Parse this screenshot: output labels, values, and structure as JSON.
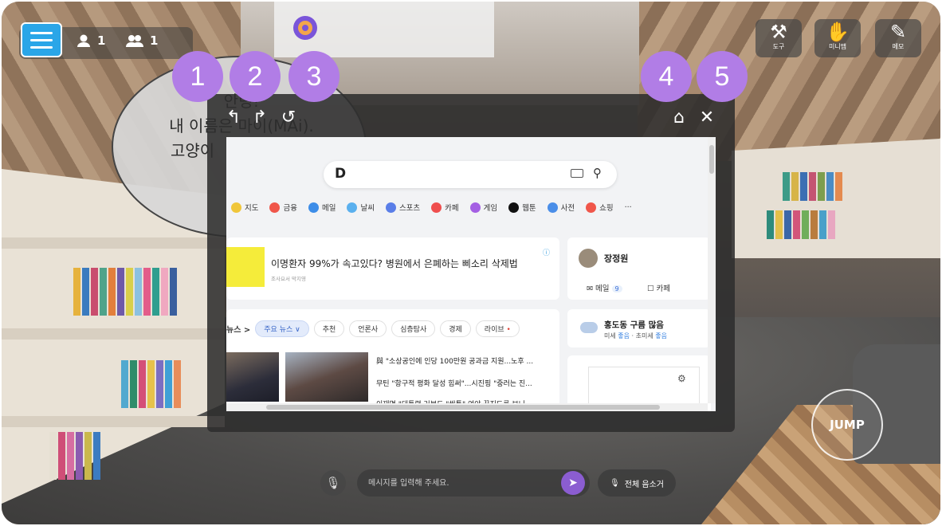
{
  "colors": {
    "accent": "#b17de6",
    "menu": "#2aa6e8",
    "send": "#8b5dd1"
  },
  "hud": {
    "menu_icon": "hamburger-icon",
    "participants_icon": "person-icon",
    "participants_count": "1",
    "group_icon": "group-icon",
    "group_count": "1"
  },
  "tools": [
    {
      "icon": "wrench-icon",
      "glyph": "⚒",
      "label": "도구"
    },
    {
      "icon": "minimap-icon",
      "glyph": "✋",
      "label": "미니맵"
    },
    {
      "icon": "memo-icon",
      "glyph": "✎",
      "label": "메모"
    }
  ],
  "badges": [
    "1",
    "2",
    "3",
    "4",
    "5"
  ],
  "speech": {
    "line1": "안녕!",
    "line2": "내 이름은 마이(MAi).",
    "line3": "고양이"
  },
  "browser": {
    "back_icon": "back-arrow-icon",
    "forward_icon": "forward-arrow-icon",
    "refresh_icon": "refresh-icon",
    "home_icon": "home-icon",
    "close_icon": "close-icon",
    "search_logo": "D",
    "categories": [
      "지도",
      "금융",
      "메일",
      "날씨",
      "스포츠",
      "카페",
      "게임",
      "웹툰",
      "사전",
      "쇼핑"
    ],
    "ad": {
      "title": "이명환자 99%가 속고있다? 병원에서 은폐하는 삐소리 삭제법",
      "sub": "조사요서 막지영"
    },
    "user": {
      "name": "장정원",
      "mail_label": "메일",
      "mail_count": "9",
      "cafe_label": "카페"
    },
    "news_tabs": [
      "뉴스 >",
      "주요 뉴스 ∨",
      "추천",
      "언론사",
      "심층탐사",
      "경제",
      "라이브"
    ],
    "headlines": [
      "與 \"소상공인에 인당 100만원 공과금 지원...노후 ...",
      "무틴 \"항구적 평화 달성 힘써\"...시진핑 \"중러는 진...",
      "이재명 \"대통령 거부도 \"쌍특\" 여야 끊지도를 보니..."
    ],
    "weather": {
      "title": "홍도동 구름 많음",
      "fine_dust_label": "미세",
      "fine_dust": "좋음",
      "ultra_dust_label": "초미세",
      "ultra_dust": "좋음"
    }
  },
  "chat": {
    "placeholder": "메시지를 입력해 주세요.",
    "mute_all": "전체 음소거"
  },
  "jump": {
    "label": "JUMP"
  }
}
